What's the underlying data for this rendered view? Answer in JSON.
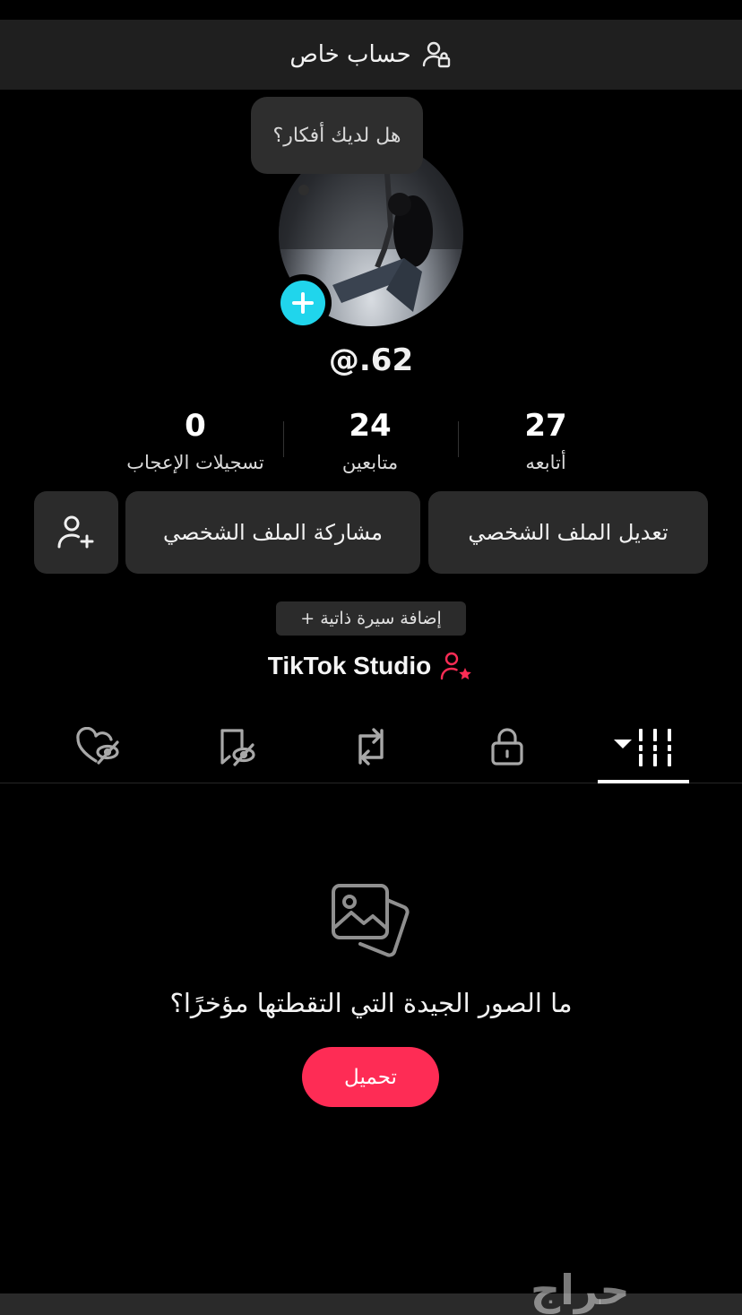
{
  "header": {
    "title": "حساب خاص",
    "icon": "private-account-icon"
  },
  "bubble": {
    "text": "هل لديك أفكار؟"
  },
  "profile": {
    "username": "@.62",
    "add_icon": "plus-icon"
  },
  "stats": [
    {
      "value": "27",
      "label": "أتابعه"
    },
    {
      "value": "24",
      "label": "متابعين"
    },
    {
      "value": "0",
      "label": "تسجيلات الإعجاب"
    }
  ],
  "buttons": {
    "edit_profile": "تعديل الملف الشخصي",
    "share_profile": "مشاركة الملف الشخصي",
    "add_friend_icon": "add-user-icon"
  },
  "bio": {
    "add_label": "+ إضافة سيرة ذاتية"
  },
  "studio": {
    "label": "TikTok Studio",
    "icon": "studio-person-star-icon"
  },
  "tabs": [
    {
      "name": "videos",
      "icon": "grid-icon",
      "active": true
    },
    {
      "name": "private",
      "icon": "lock-icon"
    },
    {
      "name": "reposts",
      "icon": "repost-icon"
    },
    {
      "name": "favorites",
      "icon": "bookmark-hidden-icon"
    },
    {
      "name": "liked",
      "icon": "heart-hidden-icon"
    }
  ],
  "empty_state": {
    "icon": "photos-icon",
    "text": "ما الصور الجيدة التي التقطتها مؤخرًا؟",
    "upload_label": "تحميل"
  },
  "watermark": {
    "text": "حراج"
  },
  "colors": {
    "accent": "#fe2c55",
    "plus": "#20d5ec",
    "background": "#000000",
    "button": "#2b2b2b"
  }
}
